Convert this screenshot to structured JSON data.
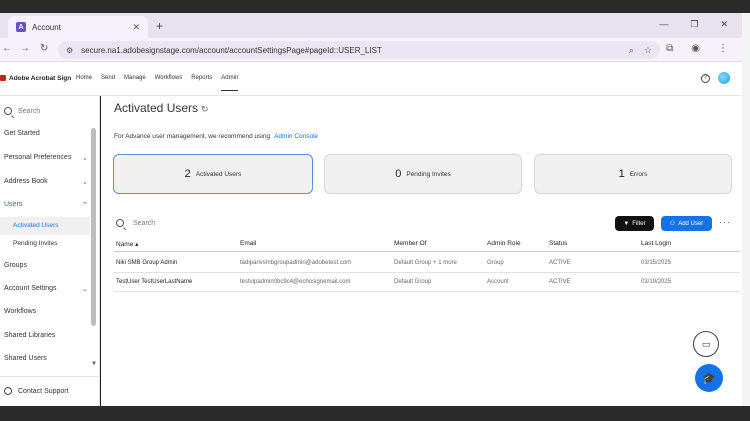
{
  "browser": {
    "tab_title": "Account",
    "url": "secure.na1.adobesignstage.com/account/accountSettingsPage#pageId::USER_LIST"
  },
  "app": {
    "brand": "Adobe Acrobat Sign",
    "nav": [
      "Home",
      "Send",
      "Manage",
      "Workflows",
      "Reports",
      "Admin"
    ],
    "active_nav": "Admin"
  },
  "sidebar": {
    "search_placeholder": "Search",
    "items": [
      {
        "label": "Get Started"
      },
      {
        "label": "Personal Preferences"
      },
      {
        "label": "Address Book"
      },
      {
        "label": "Users"
      },
      {
        "label": "Groups"
      },
      {
        "label": "Account Settings"
      },
      {
        "label": "Workflows"
      },
      {
        "label": "Shared Libraries"
      },
      {
        "label": "Shared Users"
      }
    ],
    "sub_items": [
      {
        "label": "Activated Users"
      },
      {
        "label": "Pending Invites"
      }
    ],
    "support": "Contact Support"
  },
  "main": {
    "title": "Activated Users",
    "note": "For Advance user management, we recommend using",
    "note_link": "Admin Console",
    "cards": [
      {
        "count": "2",
        "label": "Activated Users"
      },
      {
        "count": "0",
        "label": "Pending Invites"
      },
      {
        "count": "1",
        "label": "Errors"
      }
    ],
    "search_placeholder": "Search",
    "filter_label": "Filter",
    "add_user_label": "Add User",
    "columns": [
      "Name",
      "Email",
      "Member Of",
      "Admin Role",
      "Status",
      "Last Login"
    ],
    "rows": [
      {
        "name": "Niki SMB Group Admin",
        "email": "tadiparivsmbgroupadmin@adobetest.com",
        "member_of": "Default Group + 1 more",
        "role": "Group",
        "status": "ACTIVE",
        "last_login": "03/15/2025"
      },
      {
        "name": "TestUser TestUserLastName",
        "email": "testvipadmin0bc9c4@echosignemail.com",
        "member_of": "Default Group",
        "role": "Account",
        "status": "ACTIVE",
        "last_login": "03/19/2025"
      }
    ]
  }
}
